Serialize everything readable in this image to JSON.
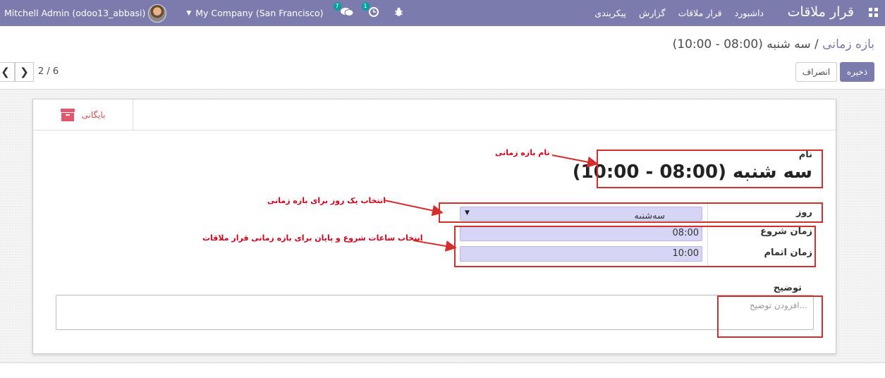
{
  "navbar": {
    "app_title": "قرار ملاقات",
    "menu": [
      "داشبورد",
      "قرار ملاقات",
      "گزارش",
      "پیکربندی"
    ],
    "user": "Mitchell Admin (odoo13_abbasi)",
    "company": "My Company (San Francisco)",
    "messages_count": "7",
    "activities_count": "1"
  },
  "control_panel": {
    "breadcrumb_parent": "بازه زمانی",
    "breadcrumb_separator": " / ",
    "breadcrumb_current": "سه شنبه (08:00 - 10:00)",
    "save_label": "ذخیره",
    "discard_label": "انصراف",
    "pager": "2 / 6"
  },
  "form": {
    "archive_label": "بایگانی",
    "name_label": "نام",
    "name_value": "سه شنبه (08:00 - 10:00)",
    "day_label": "روز",
    "day_value": "سه‌شنبه",
    "start_label": "زمان شروع",
    "start_value": "08:00",
    "end_label": "زمان اتمام",
    "end_value": "10:00",
    "description_label": "توضیح",
    "description_placeholder": "افزودن توضیح..."
  },
  "annotations": {
    "name_note": "نام بازه زمانی",
    "day_note": "انتخاب یک روز برای بازه زمانی",
    "time_note": "انتخاب ساعات شروع و پایان برای بازه زمانی قرار ملاقات"
  },
  "colors": {
    "navbar": "#7c7bad",
    "badge": "#00a09d",
    "annotation": "#d32f2f",
    "field_bg": "#d7d5f5",
    "archive": "#e2566e"
  }
}
